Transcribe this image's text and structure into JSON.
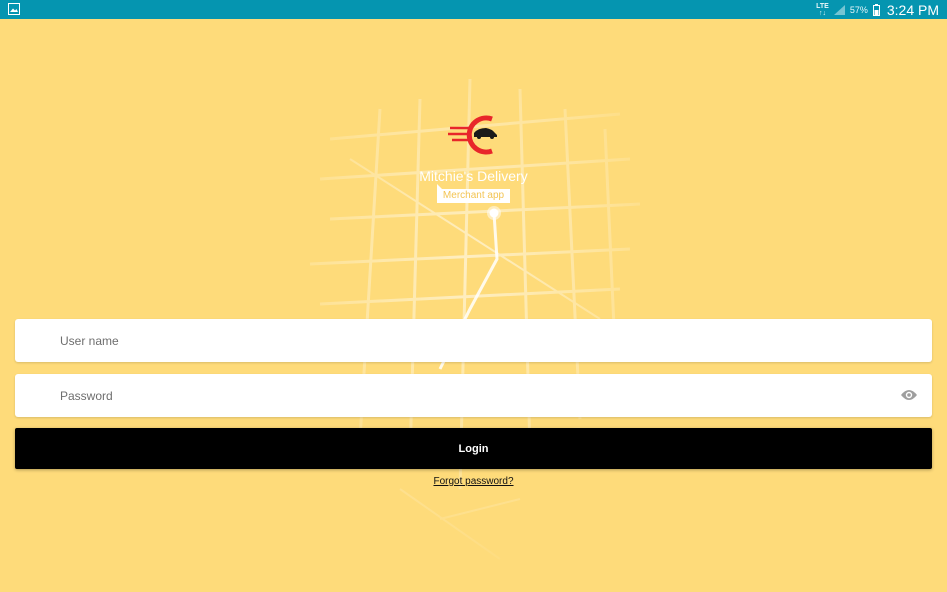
{
  "status_bar": {
    "left_icon": "gallery-notification-icon",
    "network_label": "LTE",
    "signal_icon": "signal-icon",
    "battery_percent": "57%",
    "battery_icon": "battery-icon",
    "time": "3:24 PM",
    "background_color": "#0595B0"
  },
  "brand": {
    "logo_icon": "speeding-car-logo-icon",
    "title": "Mitchie's Delivery",
    "badge": "Merchant app"
  },
  "login_form": {
    "username_placeholder": "User name",
    "password_placeholder": "Password",
    "toggle_password_icon": "eye-icon",
    "login_label": "Login",
    "forgot_password_label": "Forgot password?"
  },
  "colors": {
    "background": "#FEDB7A",
    "button": "#000000",
    "logo_red": "#E8262A"
  }
}
